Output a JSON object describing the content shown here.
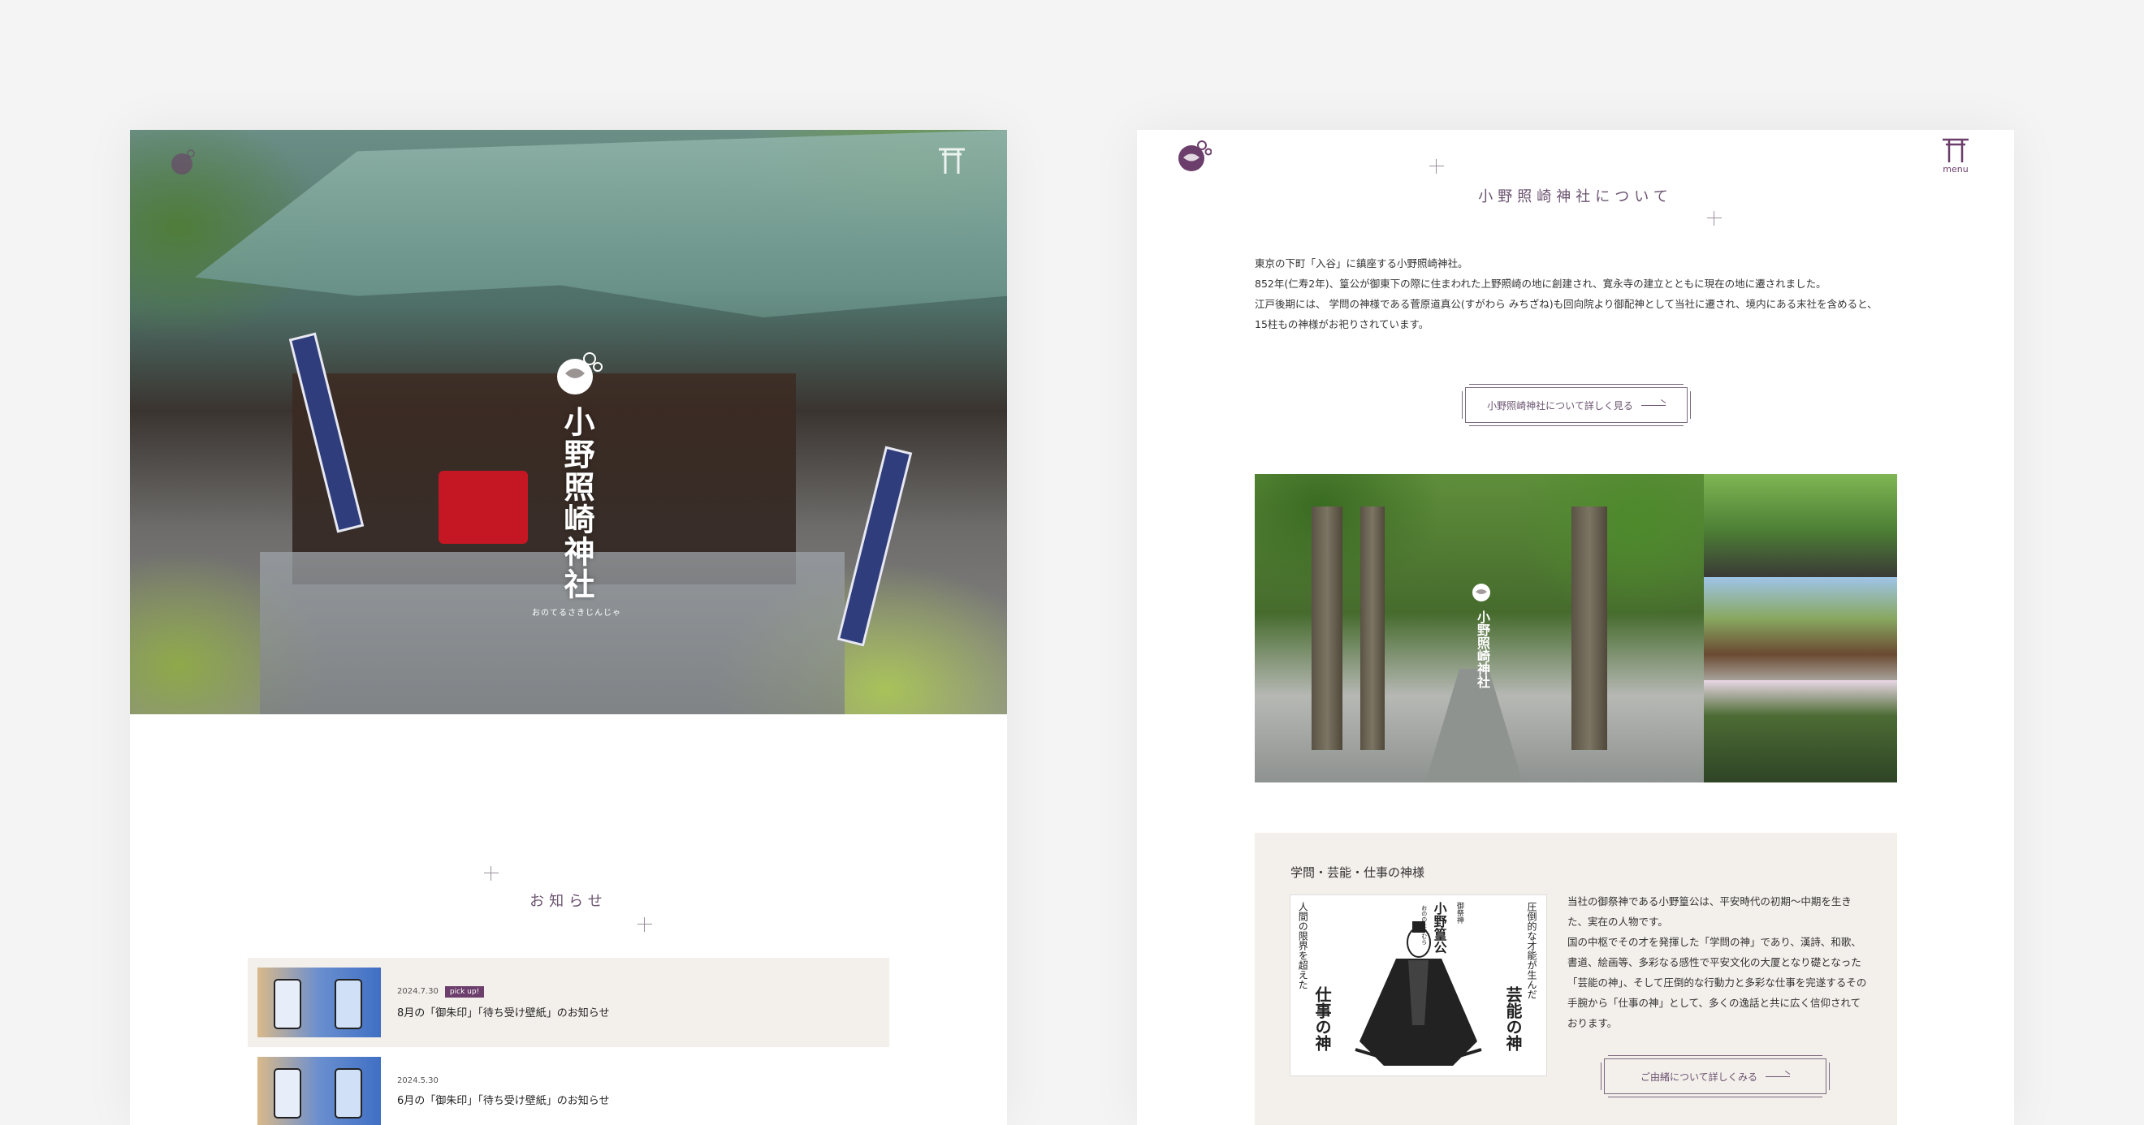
{
  "left": {
    "hero": {
      "logo_name": "小野照崎神社",
      "logo_romaji": "おのてるさきじんじゃ"
    },
    "news": {
      "title": "お知らせ",
      "items": [
        {
          "date": "2024.7.30",
          "badge": "pick up!",
          "title": "8月の「御朱印」「待ち受け壁紙」のお知らせ"
        },
        {
          "date": "2024.5.30",
          "badge": "",
          "title": "6月の「御朱印」「待ち受け壁紙」のお知らせ"
        }
      ]
    }
  },
  "right": {
    "menu_label": "menu",
    "about": {
      "title": "小野照崎神社について",
      "paragraphs": [
        "東京の下町「入谷」に鎮座する小野照崎神社。",
        "852年(仁寿2年)、篁公が御東下の際に住まわれた上野照崎の地に創建され、寛永寺の建立とともに現在の地に遷されました。",
        "江戸後期には、 学問の神様である菅原道真公(すがわら みちざね)も回向院より御配神として当社に遷され、境内にある末社を含めると、",
        "15柱もの神様がお祀りされています。"
      ],
      "button_label": "小野照崎神社について詳しく見る"
    },
    "gallery": {
      "logo_name": "小野照崎神社"
    },
    "deity": {
      "title": "学問・芸能・仕事の神様",
      "illust": {
        "right_top": "圧倒的な才能が生んだ",
        "right_big": "芸能の神",
        "center_label": "御祭神",
        "center_name": "小野篁公",
        "center_sub": "おののたかむら",
        "left_top": "人間の限界を超えた",
        "left_big": "仕事の神"
      },
      "paragraphs": [
        "当社の御祭神である小野篁公は、平安時代の初期～中期を生きた、実在の人物です。",
        "国の中枢でその才を発揮した「学問の神」であり、漢詩、和歌、書道、絵画等、多彩なる感性で平安文化の大厦となり礎となった「芸能の神」、そして圧倒的な行動力と多彩な仕事を完遂するその手腕から「仕事の神」として、多くの逸話と共に広く信仰されております。"
      ],
      "button_label": "ご由緒について詳しくみる"
    }
  },
  "colors": {
    "accent": "#6b3e6b",
    "box_bg": "#f3efeb",
    "page_bg": "#f4f4f4"
  }
}
